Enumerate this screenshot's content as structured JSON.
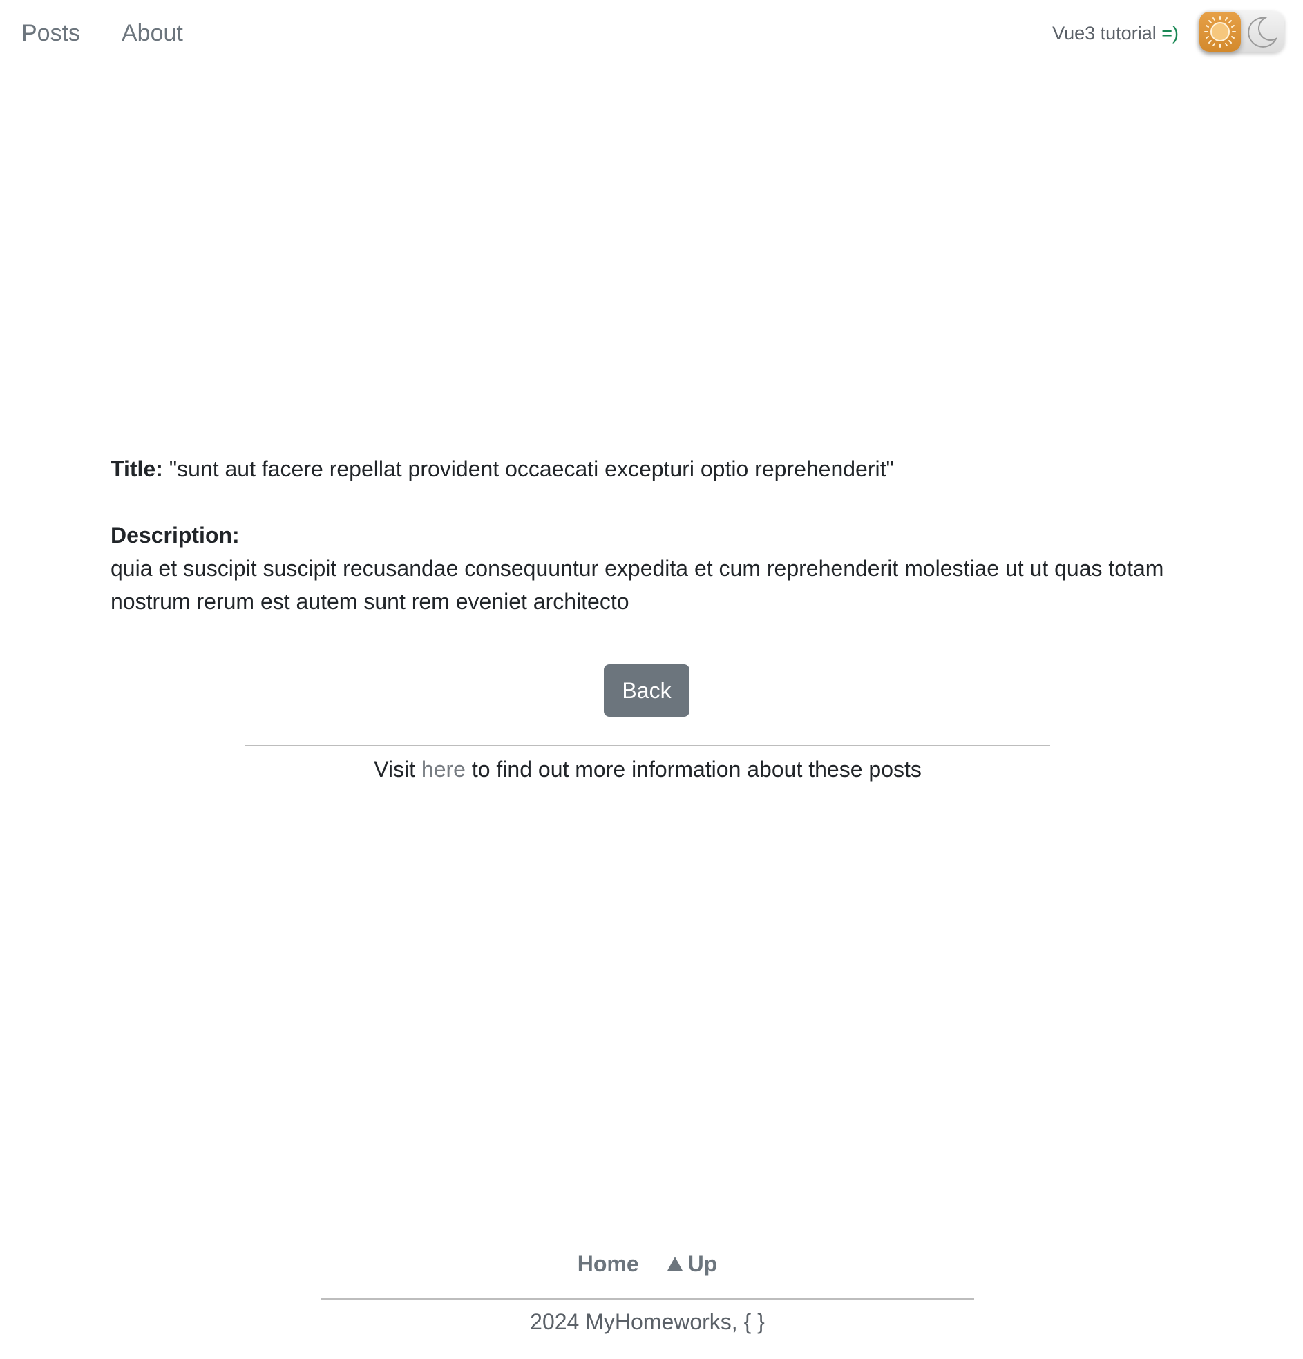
{
  "nav": {
    "links": [
      "Posts",
      "About"
    ],
    "brand_text": "Vue3 tutorial",
    "brand_smile": "=)",
    "theme_toggle": {
      "state": "light",
      "icons": [
        "sun-icon",
        "moon-icon"
      ]
    }
  },
  "post": {
    "title_label": "Title:",
    "title": "\"sunt aut facere repellat provident occaecati excepturi optio reprehenderit\"",
    "description_label": "Description:",
    "description": "quia et suscipit suscipit recusandae consequuntur expedita et cum reprehenderit molestiae ut ut quas totam nostrum rerum est autem sunt rem eveniet architecto"
  },
  "back_button": "Back",
  "info": {
    "before": "Visit",
    "link": "here",
    "after": "to find out more information about these posts"
  },
  "footer": {
    "home": "Home",
    "up": "Up",
    "copyright": "2024 MyHomeworks, { }"
  },
  "colors": {
    "link_gray": "#6c757d",
    "button_bg": "#6c757d",
    "smile_green": "#198754",
    "sun_orange": "#e6a047"
  }
}
